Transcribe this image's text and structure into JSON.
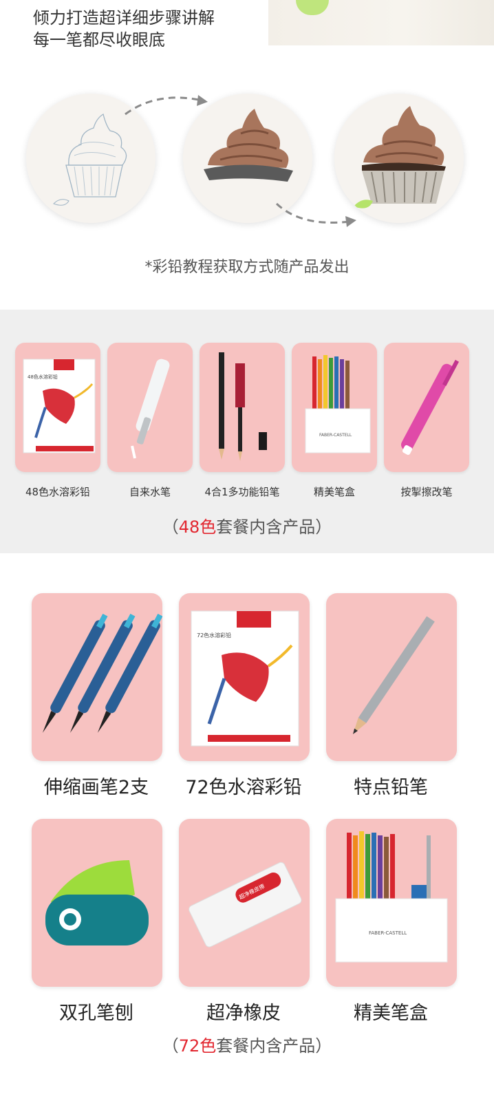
{
  "intro": {
    "line1": "倾力打造超详细步骤讲解",
    "line2": "每一笔都尽收眼底"
  },
  "steps": {
    "images": [
      "sketch",
      "colored-frosting",
      "finished-cupcake"
    ],
    "note": "*彩铅教程获取方式随产品发出"
  },
  "set48": {
    "items": [
      {
        "label": "48色水溶彩铅",
        "icon": "pencil-box-icon"
      },
      {
        "label": "自来水笔",
        "icon": "water-brush-icon"
      },
      {
        "label": "4合1多功能铅笔",
        "icon": "multi-pencil-icon"
      },
      {
        "label": "精美笔盒",
        "icon": "pen-holder-icon"
      },
      {
        "label": "按掣擦改笔",
        "icon": "eraser-pen-icon"
      }
    ],
    "summary_open": "（",
    "summary_accent": "48色",
    "summary_rest": "套餐内含产品",
    "summary_close": "）"
  },
  "set72": {
    "items": [
      {
        "label": "伸缩画笔2支",
        "icon": "brush-pens-icon"
      },
      {
        "label": "72色水溶彩铅",
        "icon": "pencil-box-icon"
      },
      {
        "label": "特点铅笔",
        "icon": "grip-pencil-icon"
      },
      {
        "label": "双孔笔刨",
        "icon": "sharpener-icon"
      },
      {
        "label": "超净橡皮",
        "icon": "eraser-icon"
      },
      {
        "label": "精美笔盒",
        "icon": "pen-holder-icon"
      }
    ],
    "summary_open": "（",
    "summary_accent": "72色",
    "summary_rest": "套餐内含产品",
    "summary_close": "）"
  },
  "brand": {
    "box_title_48": "48色水溶彩铅",
    "box_title_72": "72色水溶彩铅",
    "holder_text": "FABER-CASTELL",
    "eraser_text": "超净橡皮擦"
  },
  "colors": {
    "card_bg": "#f7c2c1",
    "accent": "#e2262f",
    "section_bg": "#efefef"
  }
}
